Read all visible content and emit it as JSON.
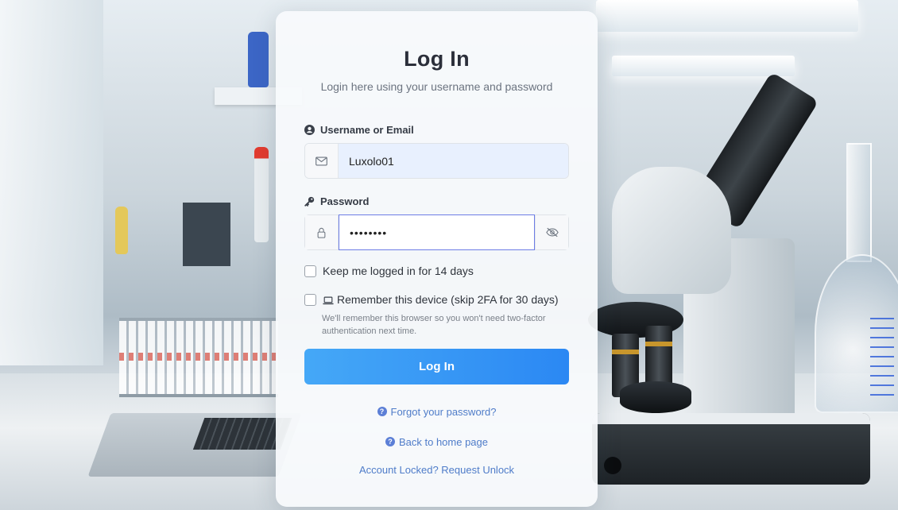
{
  "login": {
    "title": "Log In",
    "subtitle": "Login here using your username and password"
  },
  "username": {
    "label": "Username or Email",
    "value": "Luxolo01",
    "label_icon": "user-circle-icon",
    "addon_icon": "envelope-icon"
  },
  "password": {
    "label": "Password",
    "value": "••••••••",
    "label_icon": "key-icon",
    "addon_icon": "lock-icon",
    "toggle_icon": "eye-slash-icon"
  },
  "options": {
    "keep_logged_in": "Keep me logged in for 14 days",
    "remember_device": "Remember this device (skip 2FA for 30 days)",
    "remember_hint": "We'll remember this browser so you won't need two-factor authentication next time."
  },
  "actions": {
    "login_button": "Log In",
    "forgot_password": "Forgot your password?",
    "back_home": "Back to home page",
    "account_locked": "Account Locked? Request Unlock"
  },
  "colors": {
    "button_start": "#45a8f7",
    "button_end": "#2b88f3",
    "link": "#4f7cc9",
    "focus_border": "#6d7de6"
  }
}
